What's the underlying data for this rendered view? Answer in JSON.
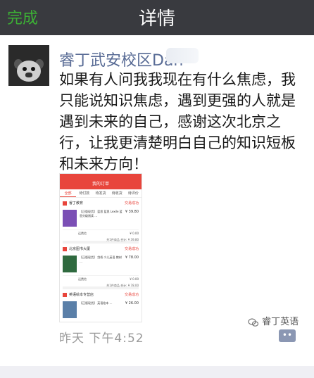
{
  "header": {
    "back_label": "完成",
    "title": "详情"
  },
  "post": {
    "author_name": "睿丁武安校区Dan",
    "content": "如果有人问我我现在有什么焦虑，我只能说知识焦虑，遇到更强的人就是遇到未来的自己，感谢这次北京之行，让我更清楚明白自己的知识短板和未来方向！",
    "time": "昨天  下午4:52",
    "comment_icon": "comment-dots-icon"
  },
  "screenshot": {
    "title": "我的订单",
    "tabs": [
      "全部",
      "待付款",
      "待发货",
      "待收货",
      "待评价"
    ],
    "shops": [
      {
        "name": "睿丁教育",
        "status": "交易成功",
        "items": [
          {
            "desc": "【正版现货】 蓝思 蓝思 Lexile 蓝思分级阅读 …",
            "price": "¥ 39.80",
            "cover": "#7b4fb5"
          }
        ],
        "lines": [
          {
            "label": "运费险",
            "value": "¥ 0.00"
          }
        ],
        "summary": "共1件商品 合计: ¥ 39.80"
      },
      {
        "name": "北京图书大厦",
        "status": "交易成功",
        "items": [
          {
            "desc": "【正版现货】 剑桥 少儿英语 教材 …",
            "price": "¥ 78.00",
            "cover": "#2f6a3f"
          }
        ],
        "lines": [
          {
            "label": "运费险",
            "value": "¥ 0.00"
          }
        ],
        "summary": "共1件商品 合计: ¥ 78.00"
      },
      {
        "name": "英语绘本专营店",
        "status": "交易成功",
        "items": [
          {
            "desc": "【正版现货】 英语绘本 …",
            "price": "¥ 26.00",
            "cover": "#5a7fa8"
          }
        ],
        "lines": [],
        "summary": ""
      }
    ]
  },
  "watermark": {
    "text": "睿丁英语"
  },
  "colors": {
    "header_bg": "#393a3f",
    "accent_green": "#3cb035",
    "name_blue": "#586b95",
    "order_red": "#e8453c"
  }
}
